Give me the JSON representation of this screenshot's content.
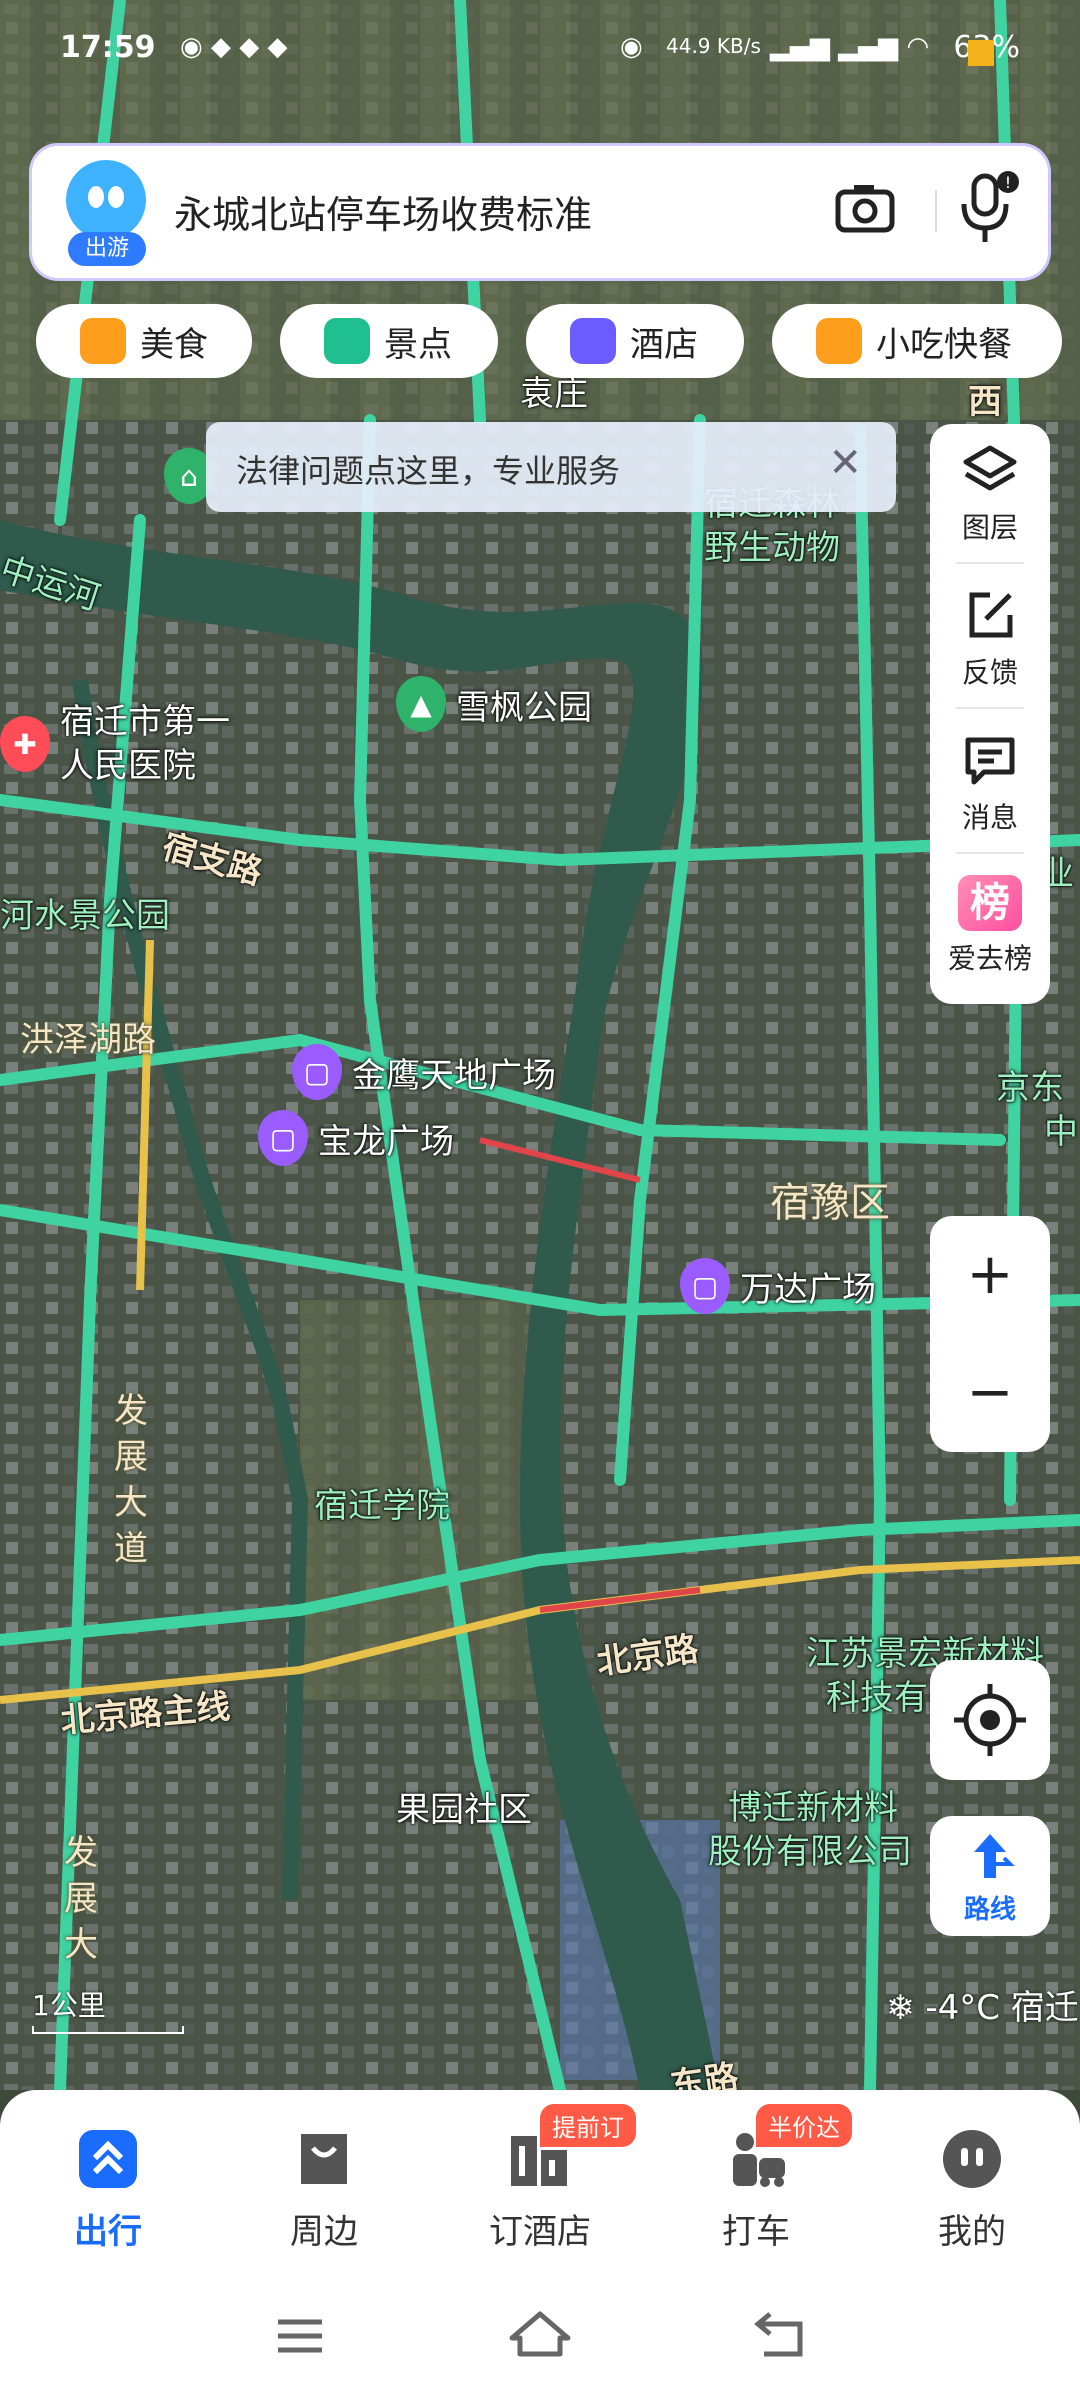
{
  "status": {
    "time": "17:59",
    "net_speed": "44.9 KB/s",
    "battery": "63%"
  },
  "search": {
    "avatar_badge": "出游",
    "query": "永城北站停车场收费标准",
    "camera_icon": "camera-icon",
    "mic_icon": "microphone-icon"
  },
  "chips": [
    {
      "label": "美食",
      "color": "#ff9d1c"
    },
    {
      "label": "景点",
      "color": "#1fbf8f"
    },
    {
      "label": "酒店",
      "color": "#6b5cff"
    },
    {
      "label": "小吃快餐",
      "color": "#ff9d1c"
    }
  ],
  "banner": {
    "text": "法律问题点这里，专业服务",
    "close": "✕"
  },
  "tools": [
    {
      "label": "图层",
      "icon": "layers-icon"
    },
    {
      "label": "反馈",
      "icon": "feedback-icon"
    },
    {
      "label": "消息",
      "icon": "message-icon"
    },
    {
      "label": "爱去榜",
      "icon": "ranking-icon",
      "glyph": "榜"
    }
  ],
  "zoom": {
    "in": "+",
    "out": "−"
  },
  "route": {
    "label": "路线"
  },
  "map": {
    "labels": {
      "yuanzhuang": "袁庄",
      "xi": "西",
      "zhongyunhe": "中运河",
      "hospital": "宿迁市第一人民医院",
      "xuefeng": "雪枫公园",
      "wildlife_1": "宿迁森林",
      "wildlife_2": "野生动物",
      "suzhi": "宿支路",
      "shuijing": "河水景公园",
      "hongze": "洪泽湖路",
      "jinying": "金鹰天地广场",
      "baolong": "宝龙广场",
      "suyu": "宿豫区",
      "wanda": "万达广场",
      "jingdong_1": "京东",
      "jingdong_2": "中",
      "fazhan_1": "发展大道",
      "xuyuan": "宿迁学院",
      "beijing": "北京路",
      "beijing_main": "北京路主线",
      "jingsu_1": "江苏景宏新材料",
      "jingsu_2": "科技有限公司",
      "guoyuan": "果园社区",
      "botian_1": "博迁新材料",
      "botian_2": "股份有限公司",
      "fazhan_2": "发展大",
      "dong_lu": "东路",
      "ye": "业"
    }
  },
  "scale": "1公里",
  "weather": {
    "temp": "-4°C",
    "city": "宿迁"
  },
  "nav": [
    {
      "label": "出行",
      "active": true
    },
    {
      "label": "周边",
      "active": false
    },
    {
      "label": "订酒店",
      "active": false,
      "tag": "提前订"
    },
    {
      "label": "打车",
      "active": false,
      "tag": "半价达"
    },
    {
      "label": "我的",
      "active": false
    }
  ]
}
